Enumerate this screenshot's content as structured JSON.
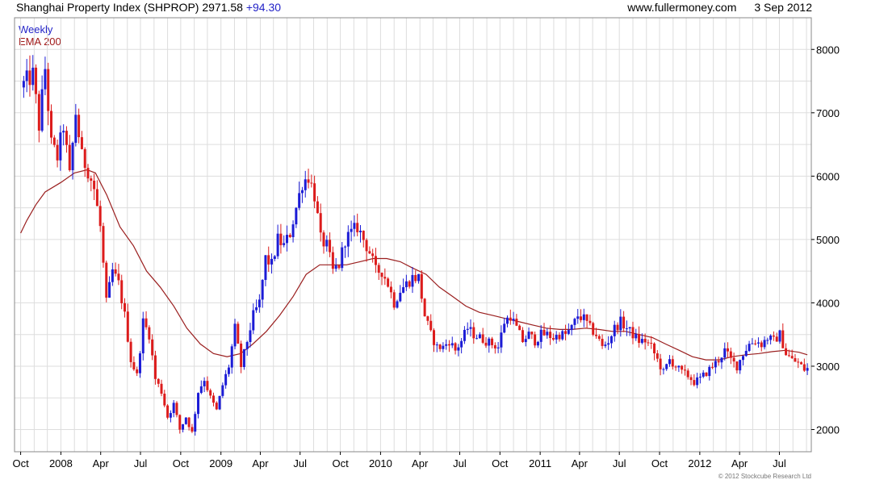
{
  "header": {
    "title": "Shanghai Property Index (SHPROP)",
    "last": "2971.58",
    "change": "+94.30",
    "source": "www.fullermoney.com",
    "date": "3 Sep 2012"
  },
  "legend": {
    "weekly": "Weekly",
    "ema": "EMA 200"
  },
  "footer": {
    "copyright": "© 2012 Stockcube Research Ltd"
  },
  "colors": {
    "up": "#1c1cd6",
    "down": "#dc1c1c",
    "ema": "#9a1e1e",
    "grid": "#dddddd",
    "frame": "#888888"
  },
  "chart_data": {
    "type": "candlestick",
    "title": "Shanghai Property Index (SHPROP)",
    "interval": "Weekly",
    "ylim": [
      1650,
      8500
    ],
    "y_ticks": [
      2000,
      3000,
      4000,
      5000,
      6000,
      7000,
      8000
    ],
    "x_ticks": [
      {
        "date": "2007-10-01",
        "label": "Oct"
      },
      {
        "date": "2008-01-01",
        "label": "2008"
      },
      {
        "date": "2008-04-01",
        "label": "Apr"
      },
      {
        "date": "2008-07-01",
        "label": "Jul"
      },
      {
        "date": "2008-10-01",
        "label": "Oct"
      },
      {
        "date": "2009-01-01",
        "label": "2009"
      },
      {
        "date": "2009-04-01",
        "label": "Apr"
      },
      {
        "date": "2009-07-01",
        "label": "Jul"
      },
      {
        "date": "2009-10-01",
        "label": "Oct"
      },
      {
        "date": "2010-01-01",
        "label": "2010"
      },
      {
        "date": "2010-04-01",
        "label": "Apr"
      },
      {
        "date": "2010-07-01",
        "label": "Jul"
      },
      {
        "date": "2010-10-01",
        "label": "Oct"
      },
      {
        "date": "2011-01-01",
        "label": "2011"
      },
      {
        "date": "2011-04-01",
        "label": "Apr"
      },
      {
        "date": "2011-07-01",
        "label": "Jul"
      },
      {
        "date": "2011-10-01",
        "label": "Oct"
      },
      {
        "date": "2012-01-01",
        "label": "2012"
      },
      {
        "date": "2012-04-01",
        "label": "Apr"
      },
      {
        "date": "2012-07-01",
        "label": "Jul"
      }
    ],
    "grid": true,
    "close_path": [
      [
        "2007-10-01",
        7400
      ],
      [
        "2007-10-29",
        7600
      ],
      [
        "2007-11-12",
        6800
      ],
      [
        "2007-11-26",
        7700
      ],
      [
        "2007-12-10",
        6500
      ],
      [
        "2007-12-24",
        6300
      ],
      [
        "2008-01-07",
        6800
      ],
      [
        "2008-01-21",
        6000
      ],
      [
        "2008-02-04",
        7000
      ],
      [
        "2008-02-18",
        6300
      ],
      [
        "2008-03-03",
        6100
      ],
      [
        "2008-03-17",
        5800
      ],
      [
        "2008-03-31",
        5200
      ],
      [
        "2008-04-14",
        4000
      ],
      [
        "2008-04-28",
        4500
      ],
      [
        "2008-05-12",
        4300
      ],
      [
        "2008-05-26",
        3800
      ],
      [
        "2008-06-09",
        3100
      ],
      [
        "2008-06-23",
        2850
      ],
      [
        "2008-07-07",
        3700
      ],
      [
        "2008-07-21",
        3500
      ],
      [
        "2008-08-04",
        2800
      ],
      [
        "2008-08-18",
        2600
      ],
      [
        "2008-09-01",
        2200
      ],
      [
        "2008-09-15",
        2400
      ],
      [
        "2008-09-29",
        2000
      ],
      [
        "2008-10-13",
        2200
      ],
      [
        "2008-10-27",
        1950
      ],
      [
        "2008-11-10",
        2600
      ],
      [
        "2008-11-24",
        2800
      ],
      [
        "2008-12-08",
        2500
      ],
      [
        "2008-12-22",
        2300
      ],
      [
        "2009-01-05",
        2700
      ],
      [
        "2009-01-19",
        3000
      ],
      [
        "2009-02-02",
        3600
      ],
      [
        "2009-02-16",
        3000
      ],
      [
        "2009-03-02",
        3400
      ],
      [
        "2009-03-16",
        3800
      ],
      [
        "2009-03-30",
        4000
      ],
      [
        "2009-04-13",
        4700
      ],
      [
        "2009-04-27",
        4600
      ],
      [
        "2009-05-11",
        5000
      ],
      [
        "2009-05-25",
        4900
      ],
      [
        "2009-06-08",
        5100
      ],
      [
        "2009-06-22",
        5500
      ],
      [
        "2009-07-06",
        5900
      ],
      [
        "2009-07-20",
        6000
      ],
      [
        "2009-08-03",
        5700
      ],
      [
        "2009-08-17",
        5000
      ],
      [
        "2009-08-31",
        4900
      ],
      [
        "2009-09-14",
        4500
      ],
      [
        "2009-09-28",
        4600
      ],
      [
        "2009-10-12",
        5000
      ],
      [
        "2009-10-26",
        5100
      ],
      [
        "2009-11-09",
        5200
      ],
      [
        "2009-11-23",
        5000
      ],
      [
        "2009-12-07",
        4800
      ],
      [
        "2009-12-21",
        4500
      ],
      [
        "2010-01-04",
        4500
      ],
      [
        "2010-01-18",
        4300
      ],
      [
        "2010-02-01",
        4000
      ],
      [
        "2010-02-15",
        4200
      ],
      [
        "2010-03-01",
        4300
      ],
      [
        "2010-03-15",
        4400
      ],
      [
        "2010-03-29",
        4400
      ],
      [
        "2010-04-12",
        3800
      ],
      [
        "2010-04-26",
        3500
      ],
      [
        "2010-05-10",
        3300
      ],
      [
        "2010-05-24",
        3300
      ],
      [
        "2010-06-07",
        3400
      ],
      [
        "2010-06-21",
        3250
      ],
      [
        "2010-07-05",
        3400
      ],
      [
        "2010-07-19",
        3600
      ],
      [
        "2010-08-02",
        3500
      ],
      [
        "2010-08-16",
        3450
      ],
      [
        "2010-08-30",
        3400
      ],
      [
        "2010-09-13",
        3350
      ],
      [
        "2010-09-27",
        3300
      ],
      [
        "2010-10-11",
        3700
      ],
      [
        "2010-10-25",
        3800
      ],
      [
        "2010-11-08",
        3600
      ],
      [
        "2010-11-22",
        3400
      ],
      [
        "2010-12-06",
        3500
      ],
      [
        "2010-12-20",
        3400
      ],
      [
        "2011-01-03",
        3500
      ],
      [
        "2011-01-17",
        3500
      ],
      [
        "2011-01-31",
        3450
      ],
      [
        "2011-02-14",
        3500
      ],
      [
        "2011-02-28",
        3500
      ],
      [
        "2011-03-14",
        3600
      ],
      [
        "2011-03-28",
        3800
      ],
      [
        "2011-04-11",
        3750
      ],
      [
        "2011-04-25",
        3600
      ],
      [
        "2011-05-09",
        3500
      ],
      [
        "2011-05-23",
        3300
      ],
      [
        "2011-06-06",
        3400
      ],
      [
        "2011-06-20",
        3600
      ],
      [
        "2011-07-04",
        3700
      ],
      [
        "2011-07-18",
        3600
      ],
      [
        "2011-08-01",
        3500
      ],
      [
        "2011-08-15",
        3400
      ],
      [
        "2011-08-29",
        3400
      ],
      [
        "2011-09-12",
        3300
      ],
      [
        "2011-09-26",
        3100
      ],
      [
        "2011-10-10",
        2900
      ],
      [
        "2011-10-24",
        3100
      ],
      [
        "2011-11-07",
        3000
      ],
      [
        "2011-11-21",
        2900
      ],
      [
        "2011-12-05",
        2850
      ],
      [
        "2011-12-19",
        2750
      ],
      [
        "2012-01-02",
        2800
      ],
      [
        "2012-01-16",
        2900
      ],
      [
        "2012-01-30",
        3000
      ],
      [
        "2012-02-13",
        3100
      ],
      [
        "2012-02-27",
        3250
      ],
      [
        "2012-03-12",
        3100
      ],
      [
        "2012-03-26",
        3000
      ],
      [
        "2012-04-09",
        3200
      ],
      [
        "2012-04-23",
        3350
      ],
      [
        "2012-05-07",
        3400
      ],
      [
        "2012-05-21",
        3350
      ],
      [
        "2012-06-04",
        3450
      ],
      [
        "2012-06-18",
        3400
      ],
      [
        "2012-07-02",
        3500
      ],
      [
        "2012-07-16",
        3200
      ],
      [
        "2012-07-30",
        3100
      ],
      [
        "2012-08-13",
        3050
      ],
      [
        "2012-08-27",
        2950
      ],
      [
        "2012-09-03",
        2971.58
      ]
    ],
    "ema_200": [
      [
        "2007-10-01",
        5100
      ],
      [
        "2007-10-15",
        5300
      ],
      [
        "2007-11-05",
        5550
      ],
      [
        "2007-11-26",
        5750
      ],
      [
        "2008-01-01",
        5900
      ],
      [
        "2008-02-01",
        6050
      ],
      [
        "2008-03-01",
        6100
      ],
      [
        "2008-03-20",
        6050
      ],
      [
        "2008-04-15",
        5700
      ],
      [
        "2008-05-15",
        5200
      ],
      [
        "2008-06-15",
        4900
      ],
      [
        "2008-07-15",
        4500
      ],
      [
        "2008-08-15",
        4250
      ],
      [
        "2008-09-15",
        3950
      ],
      [
        "2008-10-15",
        3600
      ],
      [
        "2008-11-15",
        3350
      ],
      [
        "2008-12-15",
        3200
      ],
      [
        "2009-01-15",
        3150
      ],
      [
        "2009-02-15",
        3200
      ],
      [
        "2009-03-15",
        3350
      ],
      [
        "2009-04-15",
        3550
      ],
      [
        "2009-05-15",
        3800
      ],
      [
        "2009-06-15",
        4100
      ],
      [
        "2009-07-15",
        4450
      ],
      [
        "2009-08-15",
        4600
      ],
      [
        "2009-09-15",
        4600
      ],
      [
        "2009-10-15",
        4600
      ],
      [
        "2009-11-15",
        4650
      ],
      [
        "2009-12-15",
        4700
      ],
      [
        "2010-01-15",
        4700
      ],
      [
        "2010-02-15",
        4650
      ],
      [
        "2010-03-15",
        4550
      ],
      [
        "2010-04-15",
        4450
      ],
      [
        "2010-05-15",
        4250
      ],
      [
        "2010-06-15",
        4100
      ],
      [
        "2010-07-15",
        3950
      ],
      [
        "2010-08-15",
        3850
      ],
      [
        "2010-09-15",
        3800
      ],
      [
        "2010-10-15",
        3750
      ],
      [
        "2010-11-15",
        3700
      ],
      [
        "2010-12-15",
        3650
      ],
      [
        "2011-01-15",
        3600
      ],
      [
        "2011-02-15",
        3580
      ],
      [
        "2011-03-15",
        3580
      ],
      [
        "2011-04-15",
        3600
      ],
      [
        "2011-05-15",
        3580
      ],
      [
        "2011-06-15",
        3550
      ],
      [
        "2011-07-15",
        3550
      ],
      [
        "2011-08-15",
        3500
      ],
      [
        "2011-09-15",
        3450
      ],
      [
        "2011-10-15",
        3350
      ],
      [
        "2011-11-15",
        3250
      ],
      [
        "2011-12-15",
        3150
      ],
      [
        "2012-01-15",
        3100
      ],
      [
        "2012-02-15",
        3100
      ],
      [
        "2012-03-15",
        3150
      ],
      [
        "2012-04-15",
        3180
      ],
      [
        "2012-05-15",
        3200
      ],
      [
        "2012-06-15",
        3230
      ],
      [
        "2012-07-15",
        3250
      ],
      [
        "2012-08-15",
        3220
      ],
      [
        "2012-09-03",
        3180
      ]
    ]
  }
}
